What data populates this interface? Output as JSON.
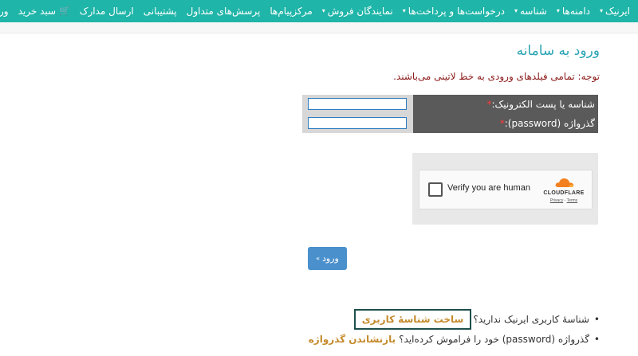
{
  "nav": {
    "items": [
      {
        "label": "ایرنیک",
        "caret": true
      },
      {
        "label": "دامنه‌ها",
        "caret": true
      },
      {
        "label": "شناسه",
        "caret": true
      },
      {
        "label": "درخواست‌ها و پرداخت‌ها",
        "caret": true
      },
      {
        "label": "نمایندگان فروش",
        "caret": true
      },
      {
        "label": "مرکزپیام‌ها",
        "caret": false
      },
      {
        "label": "پرسش‌های متداول",
        "caret": false
      },
      {
        "label": "پشتیبانی",
        "caret": false
      },
      {
        "label": "ارسال مدارک",
        "caret": false
      },
      {
        "label": "سبد خرید",
        "caret": false
      },
      {
        "label": "ورود",
        "caret": false
      }
    ],
    "caret_glyph": "▾",
    "cart_glyph": "🛒"
  },
  "page": {
    "title": "ورود به سامانه",
    "notice": "توجه: تمامی فیلدهای ورودی به خط لاتینی می‌باشند."
  },
  "form": {
    "username_label": "شناسه یا پست الکترونیک:",
    "password_label": "گذرواژه (password):",
    "required_mark": "*",
    "username_value": "",
    "password_value": ""
  },
  "captcha": {
    "verify_text": "Verify you are human",
    "brand": "CLOUDFLARE",
    "privacy": "Privacy",
    "separator": " - ",
    "terms": "Terms",
    "brand_color": "#f38020"
  },
  "submit": {
    "label": "ورود",
    "arrow": "»"
  },
  "help": {
    "bullet": "•",
    "no_account_text": "شناسهٔ کاربری ایرنیک ندارید؟",
    "register_link": "ساخت شناسهٔ کاربری",
    "forgot_text": "گذرواژه (password) خود را فراموش کرده‌اید؟",
    "reset_link": "بازنشاندن گذرواژه"
  },
  "colors": {
    "navbar": "#1fb5a8",
    "title": "#2aa4b4",
    "notice": "#8b1a1a",
    "link": "#c48a2c",
    "button": "#4a90cc"
  }
}
